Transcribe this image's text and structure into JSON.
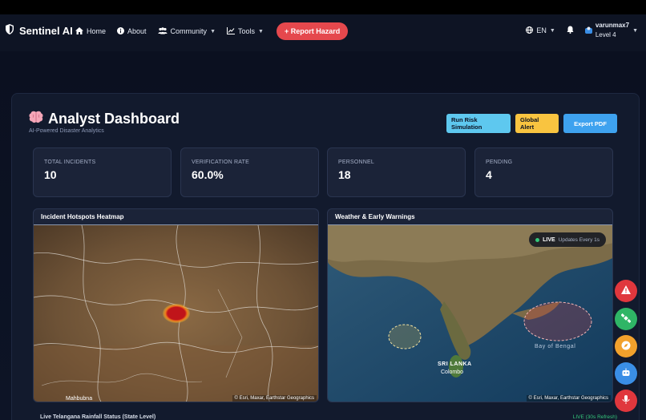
{
  "nav": {
    "brand": "Sentinel AI",
    "items": [
      {
        "label": "Home",
        "icon": "home-icon"
      },
      {
        "label": "About",
        "icon": "info-icon"
      },
      {
        "label": "Community",
        "icon": "users-icon",
        "dropdown": true
      },
      {
        "label": "Tools",
        "icon": "chart-line-icon",
        "dropdown": true
      }
    ],
    "report_button": "+ Report Hazard",
    "language": "EN",
    "user_name": "varunmax7",
    "user_level": "Level 4"
  },
  "dashboard": {
    "title": "Analyst Dashboard",
    "subtitle": "AI-Powered Disaster Analytics",
    "actions": {
      "simulation": "Run Risk Simulation",
      "alert": "Global Alert",
      "export": "Export PDF"
    },
    "stats": [
      {
        "label": "TOTAL INCIDENTS",
        "value": "10"
      },
      {
        "label": "VERIFICATION RATE",
        "value": "60.0%"
      },
      {
        "label": "PERSONNEL",
        "value": "18"
      },
      {
        "label": "PENDING",
        "value": "4"
      }
    ]
  },
  "maps": {
    "heatmap": {
      "title": "Incident Hotspots Heatmap",
      "labels": [
        "Mahbubna"
      ],
      "attribution": "© Esri, Maxar, Earthstar Geographics"
    },
    "weather": {
      "title": "Weather & Early Warnings",
      "live": "LIVE",
      "live_sub": "Updates Every 1s",
      "labels": [
        "SRI LANKA",
        "Colombo",
        "Bay of Bengal"
      ],
      "attribution": "© Esri, Maxar, Earthstar Geographics"
    }
  },
  "footer_row": {
    "title": "Live Telangana Rainfall Status (State Level)",
    "status": "LIVE (30s Refresh)"
  },
  "colors": {
    "accent_red": "#e5484d",
    "sim_blue": "#5ec8ef",
    "alert_yellow": "#f9c440",
    "pdf_blue": "#3ea2ef",
    "live_green": "#34c77b"
  }
}
